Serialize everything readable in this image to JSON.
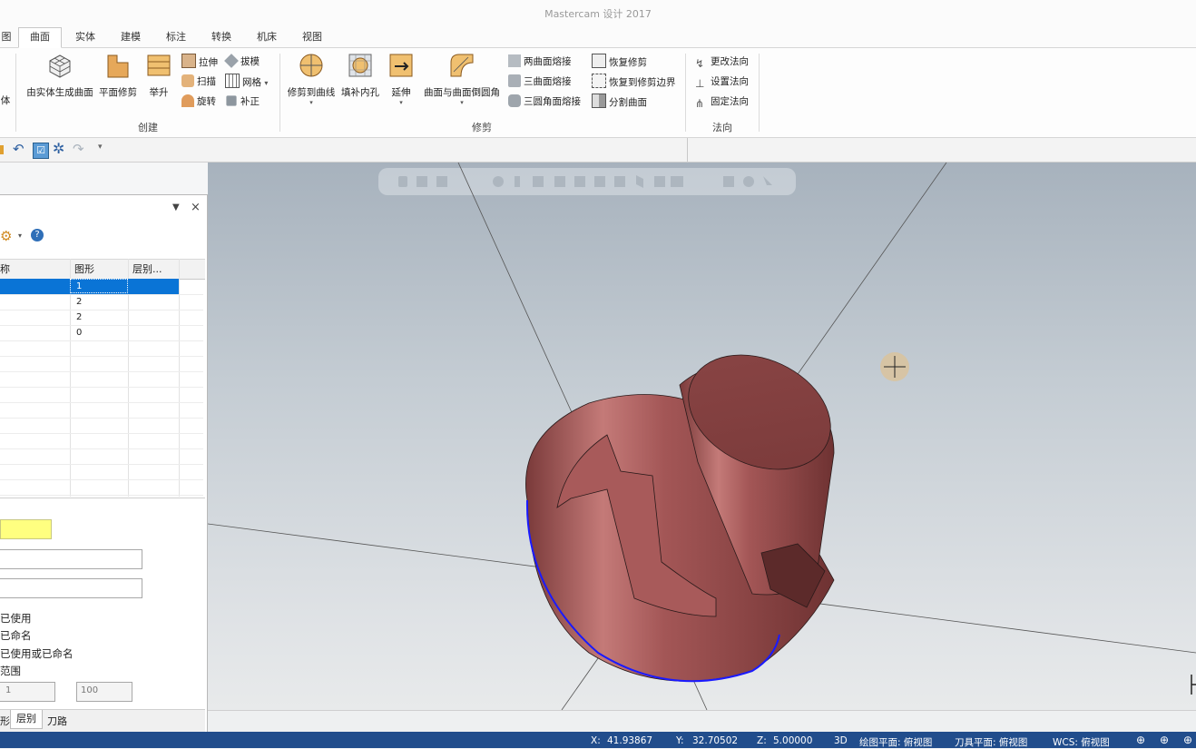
{
  "app": {
    "title": "Mastercam 设计 2017"
  },
  "tabs": [
    {
      "label": "图",
      "active": false
    },
    {
      "label": "曲面",
      "active": true
    },
    {
      "label": "实体",
      "active": false
    },
    {
      "label": "建模",
      "active": false
    },
    {
      "label": "标注",
      "active": false
    },
    {
      "label": "转换",
      "active": false
    },
    {
      "label": "机床",
      "active": false
    },
    {
      "label": "视图",
      "active": false
    }
  ],
  "ribbon": {
    "left_partial": "体",
    "create": {
      "label": "创建",
      "from_solid": "由实体生成曲面",
      "flat_trim": "平面修剪",
      "loft": "举升",
      "extrude": "拉伸",
      "sweep": "扫描",
      "revolve": "旋转",
      "draft": "拔模",
      "net": "网格",
      "patch": "补正"
    },
    "trim": {
      "label": "修剪",
      "trim_to_curve": "修剪到曲线",
      "fill_holes": "填补内孔",
      "extend": "延伸",
      "surface_fillet": "曲面与曲面倒圆角",
      "two_blend": "两曲面熔接",
      "three_blend": "三曲面熔接",
      "three_fillet_blend": "三圆角面熔接",
      "untrim": "恢复修剪",
      "untrim_to_boundary": "恢复到修剪边界",
      "split_surface": "分割曲面"
    },
    "normal": {
      "label": "法向",
      "change_normal": "更改法向",
      "set_normal": "设置法向",
      "fix_normal": "固定法向"
    }
  },
  "panel": {
    "columns": [
      "称",
      "图形",
      "层别..."
    ],
    "rows": [
      {
        "name": "",
        "count": "1",
        "layer": "",
        "selected": true
      },
      {
        "name": "",
        "count": "2",
        "layer": "",
        "selected": false
      },
      {
        "name": "",
        "count": "2",
        "layer": "",
        "selected": false
      },
      {
        "name": "",
        "count": "0",
        "layer": "",
        "selected": false
      }
    ],
    "options": [
      "已使用",
      "已命名",
      "已使用或已命名",
      "范围"
    ],
    "range_from": "1",
    "range_to": "100",
    "bottom_tabs": [
      "层别",
      "刀路"
    ],
    "bottom_tab_partial": "形"
  },
  "status": {
    "x_label": "X:",
    "x": "41.93867",
    "y_label": "Y:",
    "y": "32.70502",
    "z_label": "Z:",
    "z": "5.00000",
    "mode": "3D",
    "cplane": "绘图平面: 俯视图",
    "tplane": "刀具平面: 俯视图",
    "wcs": "WCS: 俯视图"
  },
  "colors": {
    "accent": "#214d8c",
    "selection": "#0a74d6",
    "part": "#9e4f4f",
    "yellow_field": "#ffff80"
  }
}
